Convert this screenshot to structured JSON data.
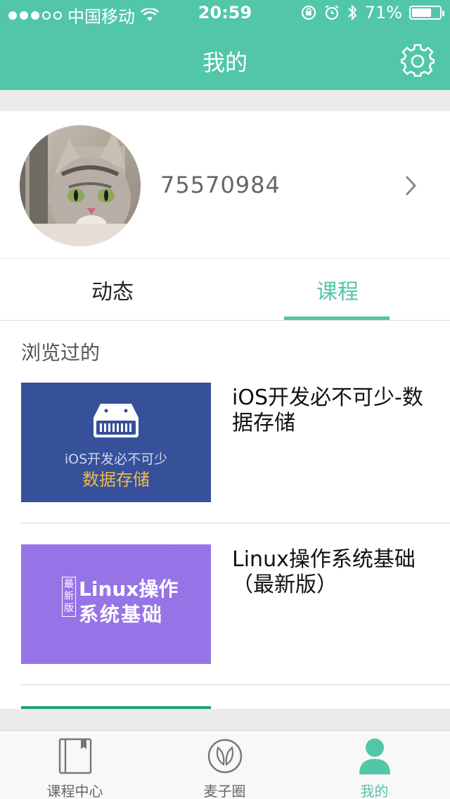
{
  "status_bar": {
    "carrier": "中国移动",
    "time": "20:59",
    "battery_percent": "71%",
    "battery_level": 0.71,
    "signal_dots_filled": 3,
    "signal_dots_total": 5
  },
  "nav": {
    "title": "我的",
    "settings_icon": "gear-icon"
  },
  "profile": {
    "user_id": "75570984",
    "avatar_icon": "cat-avatar"
  },
  "tabs": [
    {
      "label": "动态",
      "active": false
    },
    {
      "label": "课程",
      "active": true
    }
  ],
  "section": {
    "title": "浏览过的"
  },
  "courses": [
    {
      "title": "iOS开发必不可少-数据存储",
      "thumb_sub": "iOS开发必不可少",
      "thumb_main": "数据存储",
      "thumb_icon": "storage-drive-icon"
    },
    {
      "title": "Linux操作系统基础（最新版）",
      "thumb_badge": "最新版",
      "thumb_line1": "Linux操作",
      "thumb_line2": "系统基础"
    }
  ],
  "tabbar": [
    {
      "label": "课程中心",
      "icon": "book-icon",
      "active": false
    },
    {
      "label": "麦子圈",
      "icon": "leaf-icon",
      "active": false
    },
    {
      "label": "我的",
      "icon": "user-icon",
      "active": true
    }
  ],
  "colors": {
    "accent": "#52c6a8",
    "thumb1_bg": "#36509a",
    "thumb2_bg": "#9370e6"
  }
}
